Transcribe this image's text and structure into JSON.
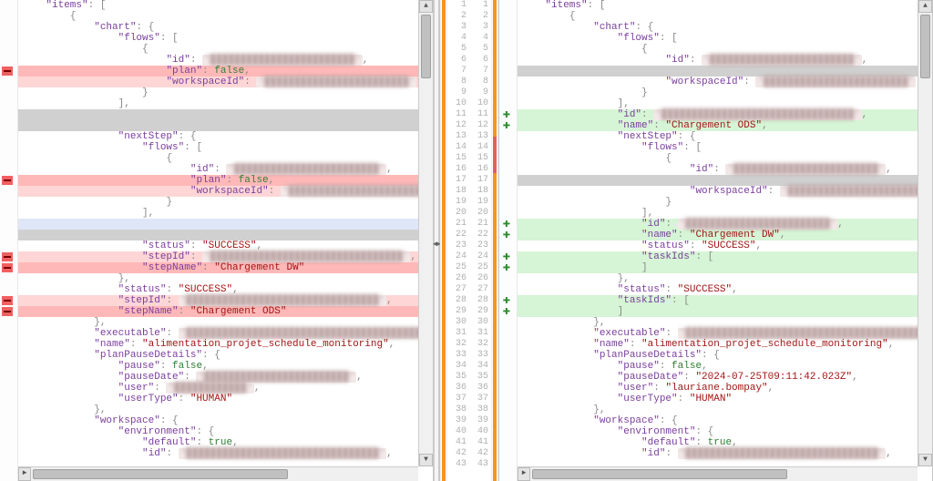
{
  "center": {
    "line_start": 1,
    "line_end": 43
  },
  "left": {
    "lines": [
      {
        "indent": 2,
        "parts": [
          {
            "k": "\"items\""
          },
          {
            "p": ": ["
          }
        ]
      },
      {
        "indent": 4,
        "parts": [
          {
            "p": "{"
          }
        ]
      },
      {
        "indent": 6,
        "parts": [
          {
            "k": "\"chart\""
          },
          {
            "p": ": {"
          }
        ]
      },
      {
        "indent": 8,
        "parts": [
          {
            "k": "\"flows\""
          },
          {
            "p": ": ["
          }
        ]
      },
      {
        "indent": 10,
        "parts": [
          {
            "p": "{"
          }
        ]
      },
      {
        "indent": 12,
        "parts": [
          {
            "k": "\"id\""
          },
          {
            "p": ": "
          },
          {
            "blur": "\"████████████████████████\""
          },
          {
            "p": ","
          }
        ]
      },
      {
        "indent": 12,
        "bg": "bg-del-strong",
        "marker": "del",
        "parts": [
          {
            "k": "\"plan\""
          },
          {
            "p": ": "
          },
          {
            "b": "false"
          },
          {
            "p": ","
          }
        ]
      },
      {
        "indent": 12,
        "bg": "bg-del",
        "parts": [
          {
            "k": "\"workspaceId\""
          },
          {
            "p": ": "
          },
          {
            "blur": "\"████████████████████████\""
          }
        ]
      },
      {
        "indent": 10,
        "parts": [
          {
            "p": "}"
          }
        ]
      },
      {
        "indent": 8,
        "parts": [
          {
            "p": "],"
          }
        ]
      },
      {
        "indent": 0,
        "bg": "bg-gap",
        "parts": [
          {
            "p": ""
          }
        ]
      },
      {
        "indent": 0,
        "bg": "bg-gap",
        "parts": [
          {
            "p": ""
          }
        ]
      },
      {
        "indent": 8,
        "parts": [
          {
            "k": "\"nextStep\""
          },
          {
            "p": ": {"
          }
        ]
      },
      {
        "indent": 10,
        "parts": [
          {
            "k": "\"flows\""
          },
          {
            "p": ": ["
          }
        ]
      },
      {
        "indent": 12,
        "parts": [
          {
            "p": "{"
          }
        ]
      },
      {
        "indent": 14,
        "parts": [
          {
            "k": "\"id\""
          },
          {
            "p": ": "
          },
          {
            "blur": "\"████████████████████████\""
          },
          {
            "p": ","
          }
        ]
      },
      {
        "indent": 14,
        "bg": "bg-del-strong",
        "marker": "del",
        "parts": [
          {
            "k": "\"plan\""
          },
          {
            "p": ": "
          },
          {
            "b": "false"
          },
          {
            "p": ","
          }
        ]
      },
      {
        "indent": 14,
        "bg": "bg-del",
        "parts": [
          {
            "k": "\"workspaceId\""
          },
          {
            "p": ": "
          },
          {
            "blur": "\"████████████████████████\""
          }
        ]
      },
      {
        "indent": 12,
        "parts": [
          {
            "p": "}"
          }
        ]
      },
      {
        "indent": 10,
        "parts": [
          {
            "p": "],"
          }
        ]
      },
      {
        "indent": 0,
        "bg": "bg-blue",
        "parts": [
          {
            "p": ""
          }
        ]
      },
      {
        "indent": 0,
        "bg": "bg-gap",
        "parts": [
          {
            "p": ""
          }
        ]
      },
      {
        "indent": 10,
        "parts": [
          {
            "k": "\"status\""
          },
          {
            "p": ": "
          },
          {
            "s": "\"SUCCESS\""
          },
          {
            "p": ","
          }
        ]
      },
      {
        "indent": 10,
        "bg": "bg-del",
        "marker": "del",
        "parts": [
          {
            "k": "\"stepId\""
          },
          {
            "p": ": "
          },
          {
            "blur": "\"████████████████████████████████\""
          },
          {
            "p": ","
          }
        ]
      },
      {
        "indent": 10,
        "bg": "bg-del-strong",
        "marker": "del",
        "parts": [
          {
            "k": "\"stepName\""
          },
          {
            "p": ": "
          },
          {
            "s": "\"Chargement DW\""
          }
        ]
      },
      {
        "indent": 8,
        "parts": [
          {
            "p": "},"
          }
        ]
      },
      {
        "indent": 8,
        "parts": [
          {
            "k": "\"status\""
          },
          {
            "p": ": "
          },
          {
            "s": "\"SUCCESS\""
          },
          {
            "p": ","
          }
        ]
      },
      {
        "indent": 8,
        "bg": "bg-del",
        "marker": "del",
        "parts": [
          {
            "k": "\"stepId\""
          },
          {
            "p": ": "
          },
          {
            "blur": "\"████████████████████████████████\""
          },
          {
            "p": ","
          }
        ]
      },
      {
        "indent": 8,
        "bg": "bg-del-strong",
        "marker": "del",
        "parts": [
          {
            "k": "\"stepName\""
          },
          {
            "p": ": "
          },
          {
            "s": "\"Chargement ODS\""
          }
        ]
      },
      {
        "indent": 6,
        "parts": [
          {
            "p": "},"
          }
        ]
      },
      {
        "indent": 6,
        "parts": [
          {
            "k": "\"executable\""
          },
          {
            "p": ": "
          },
          {
            "blur": "\"████████████████████████████████████████\""
          },
          {
            "p": ","
          }
        ]
      },
      {
        "indent": 6,
        "parts": [
          {
            "k": "\"name\""
          },
          {
            "p": ": "
          },
          {
            "s": "\"alimentation_projet_schedule_monitoring\""
          },
          {
            "p": ","
          }
        ]
      },
      {
        "indent": 6,
        "parts": [
          {
            "k": "\"planPauseDetails\""
          },
          {
            "p": ": {"
          }
        ]
      },
      {
        "indent": 8,
        "parts": [
          {
            "k": "\"pause\""
          },
          {
            "p": ": "
          },
          {
            "b": "false"
          },
          {
            "p": ","
          }
        ]
      },
      {
        "indent": 8,
        "parts": [
          {
            "k": "\"pauseDate\""
          },
          {
            "p": ": "
          },
          {
            "blur": "\"████████████████████████\""
          },
          {
            "p": ","
          }
        ]
      },
      {
        "indent": 8,
        "parts": [
          {
            "k": "\"user\""
          },
          {
            "p": ": "
          },
          {
            "blur": "\"████████████\""
          },
          {
            "p": ","
          }
        ]
      },
      {
        "indent": 8,
        "parts": [
          {
            "k": "\"userType\""
          },
          {
            "p": ": "
          },
          {
            "s": "\"HUMAN\""
          }
        ]
      },
      {
        "indent": 6,
        "parts": [
          {
            "p": "},"
          }
        ]
      },
      {
        "indent": 6,
        "parts": [
          {
            "k": "\"workspace\""
          },
          {
            "p": ": {"
          }
        ]
      },
      {
        "indent": 8,
        "parts": [
          {
            "k": "\"environment\""
          },
          {
            "p": ": {"
          }
        ]
      },
      {
        "indent": 10,
        "parts": [
          {
            "k": "\"default\""
          },
          {
            "p": ": "
          },
          {
            "b": "true"
          },
          {
            "p": ","
          }
        ]
      },
      {
        "indent": 10,
        "parts": [
          {
            "k": "\"id\""
          },
          {
            "p": ": "
          },
          {
            "blur": "\"████████████████████████████████\""
          },
          {
            "p": ","
          }
        ]
      }
    ]
  },
  "right": {
    "lines": [
      {
        "indent": 2,
        "parts": [
          {
            "k": "\"items\""
          },
          {
            "p": ": ["
          }
        ]
      },
      {
        "indent": 4,
        "parts": [
          {
            "p": "{"
          }
        ]
      },
      {
        "indent": 6,
        "parts": [
          {
            "k": "\"chart\""
          },
          {
            "p": ": {"
          }
        ]
      },
      {
        "indent": 8,
        "parts": [
          {
            "k": "\"flows\""
          },
          {
            "p": ": ["
          }
        ]
      },
      {
        "indent": 10,
        "parts": [
          {
            "p": "{"
          }
        ]
      },
      {
        "indent": 12,
        "parts": [
          {
            "k": "\"id\""
          },
          {
            "p": ": "
          },
          {
            "blur": "\"████████████████████████\""
          },
          {
            "p": ","
          }
        ]
      },
      {
        "indent": 0,
        "bg": "bg-gap",
        "parts": [
          {
            "p": ""
          }
        ]
      },
      {
        "indent": 12,
        "parts": [
          {
            "k": "\"workspaceId\""
          },
          {
            "p": ": "
          },
          {
            "blur": "\"████████████████████████\""
          }
        ]
      },
      {
        "indent": 10,
        "parts": [
          {
            "p": "}"
          }
        ]
      },
      {
        "indent": 8,
        "parts": [
          {
            "p": "],"
          }
        ]
      },
      {
        "indent": 8,
        "bg": "bg-add",
        "marker": "add",
        "parts": [
          {
            "k": "\"id\""
          },
          {
            "p": ": "
          },
          {
            "blur": "\"████████████████████████████████\""
          },
          {
            "p": ","
          }
        ]
      },
      {
        "indent": 8,
        "bg": "bg-add",
        "marker": "add",
        "parts": [
          {
            "k": "\"name\""
          },
          {
            "p": ": "
          },
          {
            "s": "\"Chargement ODS\""
          },
          {
            "p": ","
          }
        ]
      },
      {
        "indent": 8,
        "parts": [
          {
            "k": "\"nextStep\""
          },
          {
            "p": ": {"
          }
        ]
      },
      {
        "indent": 10,
        "parts": [
          {
            "k": "\"flows\""
          },
          {
            "p": ": ["
          }
        ]
      },
      {
        "indent": 12,
        "parts": [
          {
            "p": "{"
          }
        ]
      },
      {
        "indent": 14,
        "parts": [
          {
            "k": "\"id\""
          },
          {
            "p": ": "
          },
          {
            "blur": "\"████████████████████████\""
          },
          {
            "p": ","
          }
        ]
      },
      {
        "indent": 0,
        "bg": "bg-gap",
        "parts": [
          {
            "p": ""
          }
        ]
      },
      {
        "indent": 14,
        "parts": [
          {
            "k": "\"workspaceId\""
          },
          {
            "p": ": "
          },
          {
            "blur": "\"████████████████████████\""
          }
        ]
      },
      {
        "indent": 12,
        "parts": [
          {
            "p": "}"
          }
        ]
      },
      {
        "indent": 10,
        "parts": [
          {
            "p": "],"
          }
        ]
      },
      {
        "indent": 10,
        "bg": "bg-add",
        "marker": "add",
        "parts": [
          {
            "k": "\"id\""
          },
          {
            "p": ": "
          },
          {
            "blur": "\"████████████████████████\""
          },
          {
            "p": ","
          }
        ]
      },
      {
        "indent": 10,
        "bg": "bg-add",
        "marker": "add",
        "parts": [
          {
            "k": "\"name\""
          },
          {
            "p": ": "
          },
          {
            "s": "\"Chargement DW\""
          },
          {
            "p": ","
          }
        ]
      },
      {
        "indent": 10,
        "parts": [
          {
            "k": "\"status\""
          },
          {
            "p": ": "
          },
          {
            "s": "\"SUCCESS\""
          },
          {
            "p": ","
          }
        ]
      },
      {
        "indent": 10,
        "bg": "bg-add",
        "marker": "add",
        "parts": [
          {
            "k": "\"taskIds\""
          },
          {
            "p": ": ["
          }
        ]
      },
      {
        "indent": 10,
        "bg": "bg-add",
        "marker": "add",
        "parts": [
          {
            "p": "]"
          }
        ]
      },
      {
        "indent": 8,
        "parts": [
          {
            "p": "},"
          }
        ]
      },
      {
        "indent": 8,
        "parts": [
          {
            "k": "\"status\""
          },
          {
            "p": ": "
          },
          {
            "s": "\"SUCCESS\""
          },
          {
            "p": ","
          }
        ]
      },
      {
        "indent": 8,
        "bg": "bg-add",
        "marker": "add",
        "parts": [
          {
            "k": "\"taskIds\""
          },
          {
            "p": ": ["
          }
        ]
      },
      {
        "indent": 8,
        "bg": "bg-add",
        "marker": "add",
        "parts": [
          {
            "p": "]"
          }
        ]
      },
      {
        "indent": 6,
        "parts": [
          {
            "p": "},"
          }
        ]
      },
      {
        "indent": 6,
        "parts": [
          {
            "k": "\"executable\""
          },
          {
            "p": ": "
          },
          {
            "blur": "\"████████████████████████████████████████\""
          },
          {
            "p": ","
          }
        ]
      },
      {
        "indent": 6,
        "parts": [
          {
            "k": "\"name\""
          },
          {
            "p": ": "
          },
          {
            "s": "\"alimentation_projet_schedule_monitoring\""
          },
          {
            "p": ","
          }
        ]
      },
      {
        "indent": 6,
        "parts": [
          {
            "k": "\"planPauseDetails\""
          },
          {
            "p": ": {"
          }
        ]
      },
      {
        "indent": 8,
        "parts": [
          {
            "k": "\"pause\""
          },
          {
            "p": ": "
          },
          {
            "b": "false"
          },
          {
            "p": ","
          }
        ]
      },
      {
        "indent": 8,
        "parts": [
          {
            "k": "\"pauseDate\""
          },
          {
            "p": ": "
          },
          {
            "s": "\"2024-07-25T09:11:42.023Z\""
          },
          {
            "p": ","
          }
        ]
      },
      {
        "indent": 8,
        "parts": [
          {
            "k": "\"user\""
          },
          {
            "p": ": "
          },
          {
            "s": "\"lauriane.bompay\""
          },
          {
            "p": ","
          }
        ]
      },
      {
        "indent": 8,
        "parts": [
          {
            "k": "\"userType\""
          },
          {
            "p": ": "
          },
          {
            "s": "\"HUMAN\""
          }
        ]
      },
      {
        "indent": 6,
        "parts": [
          {
            "p": "},"
          }
        ]
      },
      {
        "indent": 6,
        "parts": [
          {
            "k": "\"workspace\""
          },
          {
            "p": ": {"
          }
        ]
      },
      {
        "indent": 8,
        "parts": [
          {
            "k": "\"environment\""
          },
          {
            "p": ": {"
          }
        ]
      },
      {
        "indent": 10,
        "parts": [
          {
            "k": "\"default\""
          },
          {
            "p": ": "
          },
          {
            "b": "true"
          },
          {
            "p": ","
          }
        ]
      },
      {
        "indent": 10,
        "parts": [
          {
            "k": "\"id\""
          },
          {
            "p": ": "
          },
          {
            "blur": "\"████████████████████████████████\""
          },
          {
            "p": ","
          }
        ]
      }
    ]
  }
}
